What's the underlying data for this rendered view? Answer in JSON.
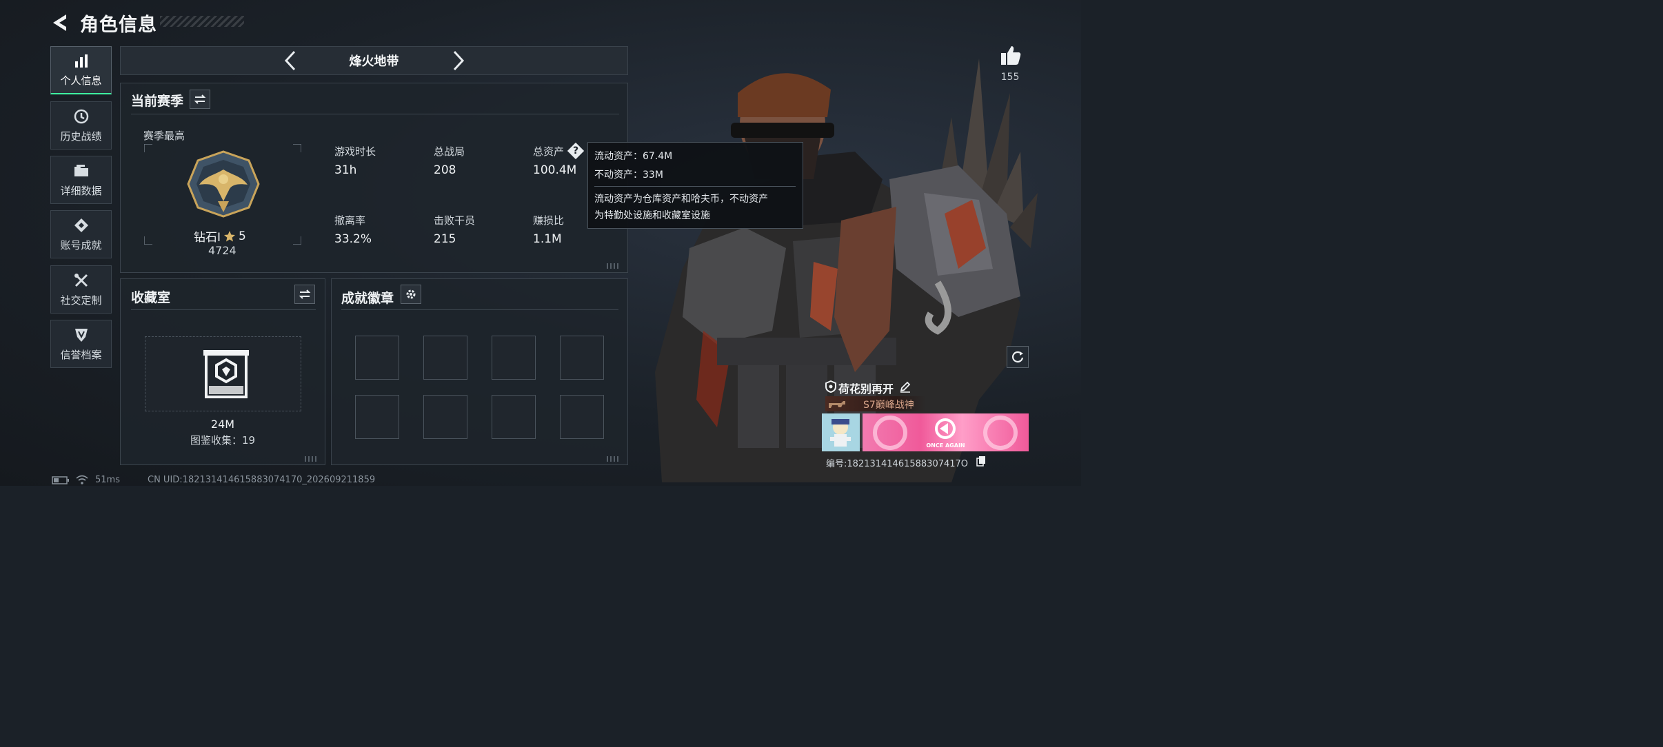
{
  "header": {
    "title": "角色信息"
  },
  "sidebar": {
    "items": [
      {
        "label": "个人信息",
        "icon": "bar-chart-icon",
        "active": true
      },
      {
        "label": "历史战绩",
        "icon": "history-clock-icon",
        "active": false
      },
      {
        "label": "详细数据",
        "icon": "folder-icon",
        "active": false
      },
      {
        "label": "账号成就",
        "icon": "achievement-diamond-icon",
        "active": false
      },
      {
        "label": "社交定制",
        "icon": "tools-icon",
        "active": false
      },
      {
        "label": "信誉档案",
        "icon": "shield-badge-icon",
        "active": false
      }
    ]
  },
  "mode_tab": {
    "name": "烽火地带"
  },
  "season": {
    "title": "当前赛季",
    "peak_label": "赛季最高",
    "rank_name": "钻石Ⅰ",
    "rank_stars": "5",
    "rank_score": "4724",
    "stats": [
      {
        "label": "游戏时长",
        "value": "31h"
      },
      {
        "label": "总战局",
        "value": "208"
      },
      {
        "label": "总资产",
        "value": "100.4M"
      },
      {
        "label": "撤离率",
        "value": "33.2%"
      },
      {
        "label": "击败干员",
        "value": "215"
      },
      {
        "label": "赚损比",
        "value": "1.1M"
      }
    ]
  },
  "tooltip": {
    "liquid": "流动资产：67.4M",
    "fixed": "不动资产：33M",
    "desc_line1": "流动资产为仓库资产和哈夫币，不动资产",
    "desc_line2": "为特勤处设施和收藏室设施"
  },
  "collection": {
    "title": "收藏室",
    "value": "24M",
    "catalog": "图鉴收集：19"
  },
  "badges": {
    "title": "成就徽章",
    "slots": 8
  },
  "profile": {
    "likes": "155",
    "name": "荷花别再开",
    "title_badge": "S7巅峰战神",
    "id_label": "编号:18213141461588307417O",
    "banner_text": "ONCE AGAIN"
  },
  "status_bar": {
    "ping": "51ms",
    "uid": "CN UID:182131414615883074170_202609211859"
  },
  "colors": {
    "accent": "#3ef0a0",
    "panel_border": "#3a434c",
    "banner_pink": "#f05a9a"
  }
}
